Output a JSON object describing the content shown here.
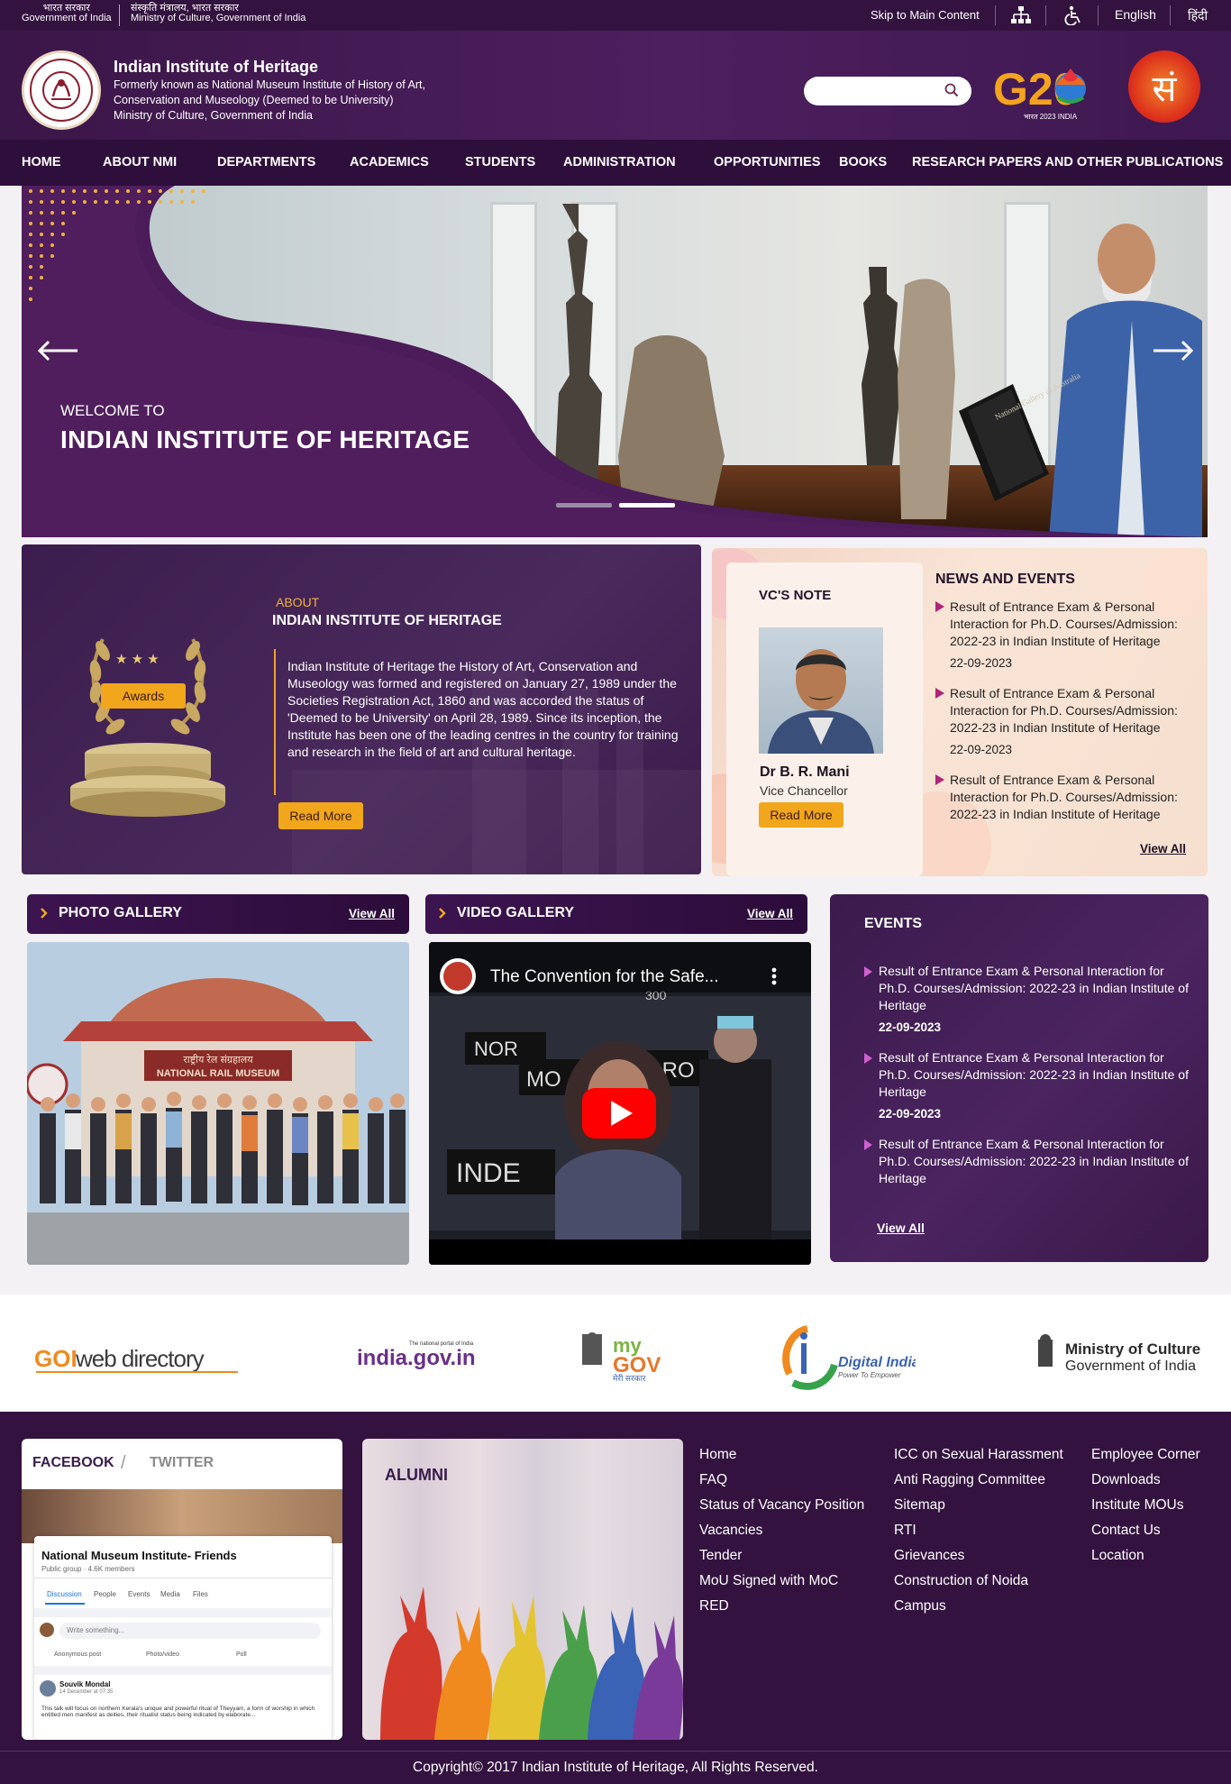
{
  "gov": {
    "hindi_gov": "भारत सरकार",
    "gov_india": "Government of India",
    "hindi_ministry": "संस्कृति मंत्रालय, भारत सरकार",
    "ministry": "Ministry of Culture, Government of India",
    "skip": "Skip to Main Content",
    "lang_en": "English",
    "lang_hi": "हिंदी"
  },
  "header": {
    "title": "Indian Institute of Heritage",
    "sub1": "Formerly known as National Museum Institute of History of Art,",
    "sub2": "Conservation and Museology (Deemed to be University)",
    "sub3": "Ministry of Culture, Government of India",
    "g20_text": "G20",
    "g20_sub": "भारत 2023 INDIA",
    "sanskriti_glyph": "सं"
  },
  "nav": [
    "HOME",
    "ABOUT NMI",
    "DEPARTMENTS",
    "ACADEMICS",
    "STUDENTS",
    "ADMINISTRATION",
    "OPPORTUNITIES",
    "BOOKS",
    "RESEARCH PAPERS AND OTHER PUBLICATIONS"
  ],
  "hero": {
    "welcome": "WELCOME TO",
    "title": "INDIAN INSTITUTE OF HERITAGE",
    "active_slide": 2,
    "slide_count": 2,
    "book_text": "National Gallery of Australia"
  },
  "about": {
    "kicker": "ABOUT",
    "title": "INDIAN INSTITUTE OF HERITAGE",
    "body": "Indian Institute of Heritage the History of Art, Conservation and Museology was formed and registered on January 27, 1989 under the Societies Registration Act, 1860 and was accorded the status of 'Deemed to be University' on April 28, 1989. Since its inception, the Institute has been one of the leading centres in the country for training and research in the field of art and cultural heritage.",
    "read_more": "Read More",
    "awards": "Awards",
    "stars": "★ ★ ★"
  },
  "vc": {
    "heading": "VC'S NOTE",
    "name": "Dr B. R. Mani",
    "role": "Vice Chancellor",
    "read_more": "Read More"
  },
  "news": {
    "heading": "NEWS AND EVENTS",
    "items": [
      {
        "text": "Result of Entrance Exam & Personal Interaction for Ph.D. Courses/Admission: 2022-23 in Indian Institute of Heritage",
        "date": "22-09-2023"
      },
      {
        "text": "Result of Entrance Exam & Personal Interaction for Ph.D. Courses/Admission: 2022-23 in Indian Institute of Heritage",
        "date": "22-09-2023"
      },
      {
        "text": "Result of Entrance Exam & Personal Interaction for Ph.D. Courses/Admission: 2022-23 in Indian Institute of Heritage",
        "date": ""
      }
    ],
    "view_all": "View All"
  },
  "photo_gallery": {
    "title": "PHOTO GALLERY",
    "view_all": "View All",
    "sign_text": "राष्ट्रीय रेल संग्रहालय",
    "sign_en": "NATIONAL RAIL MUSEUM"
  },
  "video_gallery": {
    "title": "VIDEO GALLERY",
    "view_all": "View All",
    "video_title": "The Convention for the Safe...",
    "desk1": "NOR",
    "desk2": "MO",
    "desk3": "GRO",
    "desk4": "INDE",
    "desk5": "300"
  },
  "events": {
    "heading": "EVENTS",
    "items": [
      {
        "text": "Result of Entrance Exam & Personal Interaction for Ph.D. Courses/Admission: 2022-23 in Indian Institute of Heritage",
        "date": "22-09-2023"
      },
      {
        "text": "Result of Entrance Exam & Personal Interaction for Ph.D. Courses/Admission: 2022-23 in Indian Institute of Heritage",
        "date": "22-09-2023"
      },
      {
        "text": "Result of Entrance Exam & Personal Interaction for Ph.D. Courses/Admission: 2022-23 in Indian Institute of Heritage",
        "date": ""
      }
    ],
    "view_all": "View All"
  },
  "partners": {
    "goi_a": "GOI",
    "goi_b": "web directory",
    "india_gov_small": "The national portal of India",
    "india_gov": "india.gov.in",
    "mygov_my": "my",
    "mygov_gov": "GOV",
    "mygov_sub": "मेरी सरकार",
    "digital_india": "Digital India",
    "digital_india_sub": "Power To Empower",
    "moc_1": "Ministry of Culture",
    "moc_2": "Government of India"
  },
  "social": {
    "facebook": "FACEBOOK",
    "sep": "/",
    "twitter": "TWITTER",
    "group_name": "National Museum Institute- Friends",
    "group_meta": "Public group · 4.6K members",
    "tabs": [
      "Discussion",
      "People",
      "Events",
      "Media",
      "Files"
    ],
    "composer": "Write something...",
    "actions": [
      "Anonymous post",
      "Photo/video",
      "Poll"
    ],
    "post_author": "Souvik Mondal",
    "post_time": "14 December at 07:35 · ",
    "post_text": "This talk will focus on northern Kerala's unique and powerful ritual of Theyyam, a form of worship in which entitled men manifest as deities, their ritualist status being indicated by elaborate..."
  },
  "alumni": {
    "title": "ALUMNI"
  },
  "footer": {
    "col1": [
      "Home",
      "FAQ",
      "Status of Vacancy Position",
      "Vacancies",
      "Tender",
      "MoU Signed with MoC",
      "RED"
    ],
    "col2": [
      "ICC on Sexual Harassment",
      "Anti Ragging Committee",
      "Sitemap",
      "RTI",
      "Grievances",
      "Construction of Noida",
      "Campus"
    ],
    "col3": [
      "Employee Corner",
      "Downloads",
      "Institute MOUs",
      "Contact Us",
      "Location"
    ],
    "copyright": "Copyright© 2017 Indian Institute of Heritage, All Rights Reserved."
  },
  "colors": {
    "brand_purple": "#33123f",
    "accent_gold": "#f1a61c",
    "news_arrow": "#b2237b"
  }
}
